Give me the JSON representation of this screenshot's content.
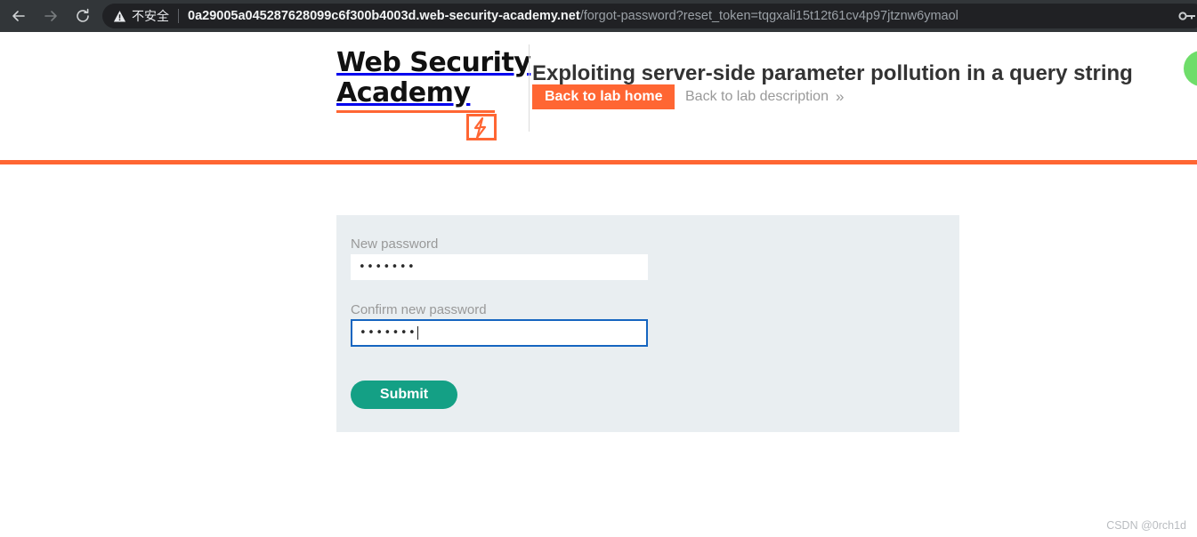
{
  "browser": {
    "back_icon": "back-arrow-icon",
    "forward_icon": "forward-arrow-icon",
    "reload_icon": "reload-icon",
    "security_warning": "不安全",
    "security_icon": "warning-triangle-icon",
    "url_host": "0a29005a045287628099c6f300b4003d.web-security-academy.net",
    "url_path": "/forgot-password?reset_token=tqgxali15t12t61cv4p97jtznw6ymaol",
    "password_manager_icon": "key-icon",
    "chrome_bg": "#323639",
    "omnibox_bg": "#202124"
  },
  "header": {
    "logo_line1": "Web Security",
    "logo_line2": "Academy",
    "logo_mark_icon": "lightning-bolt-icon",
    "lab_title": "Exploiting server-side parameter pollution in a query string",
    "back_to_lab_home": "Back to lab home",
    "back_to_lab_description": "Back to lab description",
    "chevron": "»",
    "accent_orange": "#ff6633",
    "status_badge_color": "#6fdd6a"
  },
  "form": {
    "new_password_label": "New password",
    "new_password_value": "•••••••",
    "confirm_password_label": "Confirm new password",
    "confirm_password_value": "•••••••",
    "submit_label": "Submit",
    "panel_bg": "#e9eef1",
    "focus_border_color": "#1565c0",
    "submit_color": "#14a085"
  },
  "footer": {
    "watermark": "CSDN @0rch1d"
  }
}
